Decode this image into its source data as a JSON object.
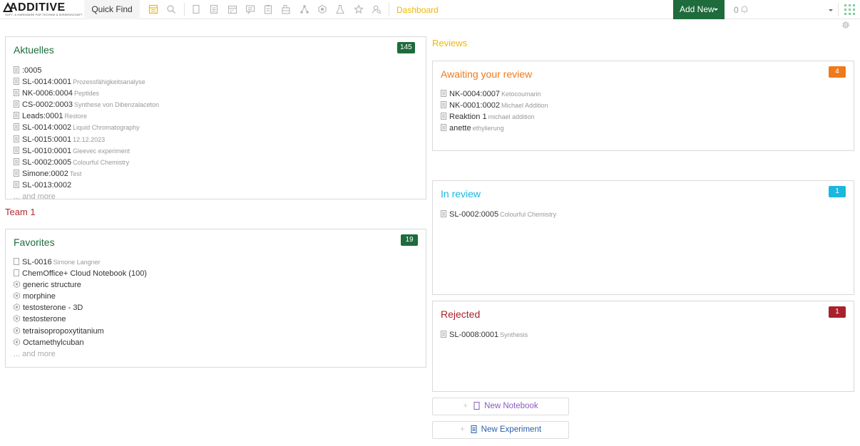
{
  "topbar": {
    "logo_word": "ADDITIVE",
    "logo_tagline": "SOFT- & HARDWARE FÜR TECHNIK & WISSENSCHAFT",
    "quick_find": "Quick Find",
    "dashboard": "Dashboard",
    "add_new": "Add New",
    "notification_count": "0"
  },
  "aktuelles": {
    "title": "Aktuelles",
    "badge": "145",
    "items": [
      {
        "name": ":0005",
        "sub": ""
      },
      {
        "name": "SL-0014:0001",
        "sub": "Prozessfähigkeitsanalyse"
      },
      {
        "name": "NK-0006:0004",
        "sub": "Peptides"
      },
      {
        "name": "CS-0002:0003",
        "sub": "Synthese von Dibenzalaceton"
      },
      {
        "name": "Leads:0001",
        "sub": "Restore"
      },
      {
        "name": "SL-0014:0002",
        "sub": "Liquid Chromatography"
      },
      {
        "name": "SL-0015:0001",
        "sub": "12.12.2023"
      },
      {
        "name": "SL-0010:0001",
        "sub": "Gleevec experiment"
      },
      {
        "name": "SL-0002:0005",
        "sub": "Colourful Chemistry"
      },
      {
        "name": "Simone:0002",
        "sub": "Test"
      },
      {
        "name": "SL-0013:0002",
        "sub": ""
      }
    ],
    "more": "... and more"
  },
  "team_label": "Team 1",
  "favorites": {
    "title": "Favorites",
    "badge": "19",
    "items": [
      {
        "name": "SL-0016",
        "sub": "Simone Langner",
        "icon": "notebook-icon"
      },
      {
        "name": "ChemOffice+ Cloud Notebook (100)",
        "sub": "",
        "icon": "notebook-icon"
      },
      {
        "name": "generic structure",
        "sub": "",
        "icon": "structure-icon"
      },
      {
        "name": "morphine",
        "sub": "",
        "icon": "structure-icon"
      },
      {
        "name": "testosterone - 3D",
        "sub": "",
        "icon": "structure-icon"
      },
      {
        "name": "testosterone",
        "sub": "",
        "icon": "structure-icon"
      },
      {
        "name": "tetraisopropoxytitanium",
        "sub": "",
        "icon": "structure-icon"
      },
      {
        "name": "Octamethylcuban",
        "sub": "",
        "icon": "structure-icon"
      }
    ],
    "more": "... and more"
  },
  "reviews_label": "Reviews",
  "awaiting": {
    "title": "Awaiting your review",
    "badge": "4",
    "items": [
      {
        "name": "NK-0004:0007",
        "sub": "Ketocoumarin"
      },
      {
        "name": "NK-0001:0002",
        "sub": "Michael Addition"
      },
      {
        "name": "Reaktion 1",
        "sub": "michael addition"
      },
      {
        "name": "anette",
        "sub": "ethylierung"
      }
    ]
  },
  "in_review": {
    "title": "In review",
    "badge": "1",
    "items": [
      {
        "name": "SL-0002:0005",
        "sub": "Colourful Chemistry"
      }
    ]
  },
  "rejected": {
    "title": "Rejected",
    "badge": "1",
    "items": [
      {
        "name": "SL-0008:0001",
        "sub": "Synthesis"
      }
    ]
  },
  "buttons": {
    "new_notebook": "New Notebook",
    "new_experiment": "New Experiment"
  },
  "colors": {
    "brand_green": "#1e6b3c",
    "reviews_yellow": "#f0b800",
    "awaiting_orange": "#f07a1a",
    "in_review_cyan": "#1ab7e0",
    "rejected_red": "#a8222c",
    "team_red": "#b02a30",
    "new_notebook_purple": "#8a5bbf",
    "new_experiment_blue": "#2a5fa8"
  }
}
